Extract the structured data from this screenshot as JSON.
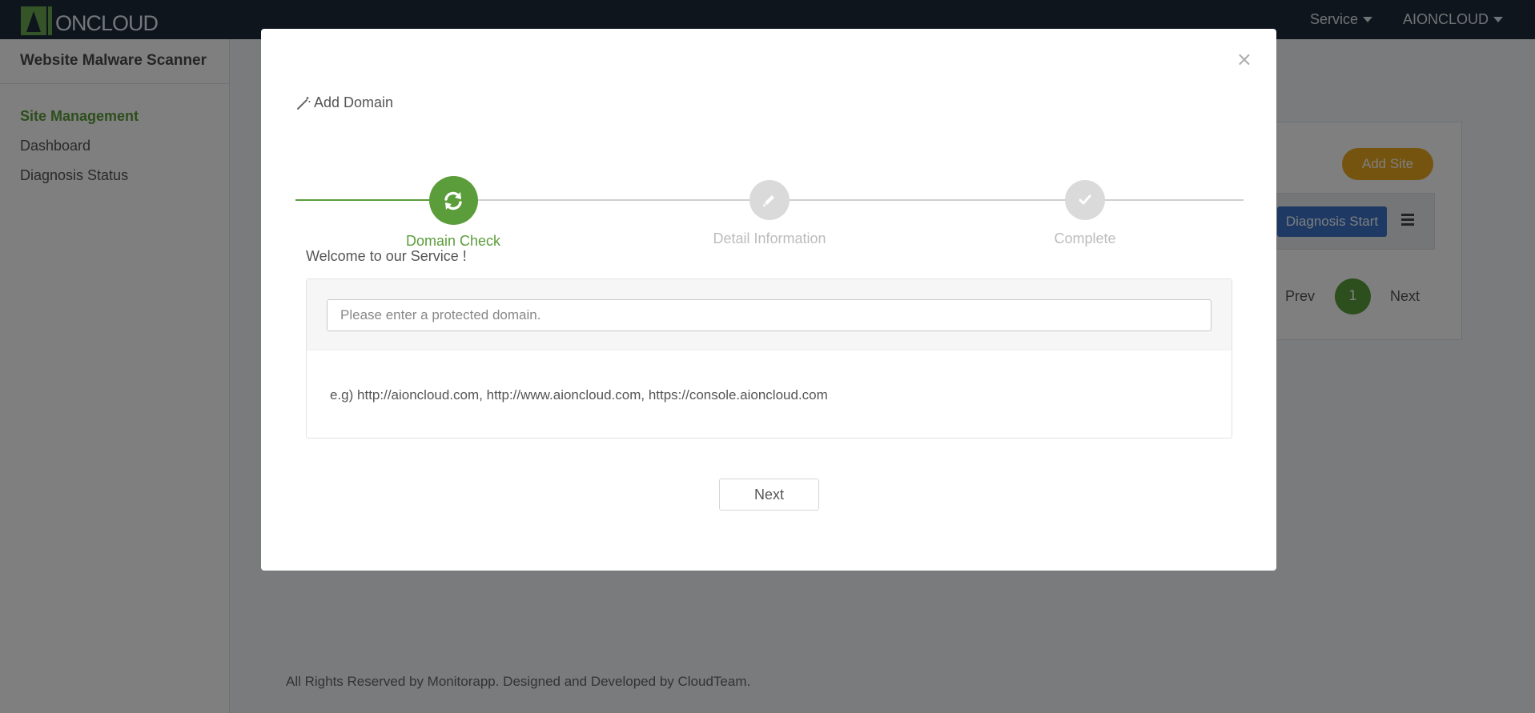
{
  "header": {
    "logo_text": "ONCLOUD",
    "nav": [
      {
        "label": "Service"
      },
      {
        "label": "AIONCLOUD"
      }
    ]
  },
  "sidebar": {
    "title": "Website Malware Scanner",
    "items": [
      {
        "label": "Site Management",
        "active": true
      },
      {
        "label": "Dashboard",
        "active": false
      },
      {
        "label": "Diagnosis Status",
        "active": false
      }
    ]
  },
  "background": {
    "add_site_label": "Add Site",
    "diagnosis_start_label": "Diagnosis Start",
    "pagination": {
      "prev": "Prev",
      "current": "1",
      "next": "Next"
    },
    "footer": "All Rights Reserved by Monitorapp. Designed and Developed by CloudTeam."
  },
  "modal": {
    "close_label": "×",
    "title": "Add Domain",
    "steps": [
      {
        "label": "Domain Check",
        "icon": "refresh-icon",
        "state": "active"
      },
      {
        "label": "Detail Information",
        "icon": "pencil-icon",
        "state": "pending"
      },
      {
        "label": "Complete",
        "icon": "check-icon",
        "state": "pending"
      }
    ],
    "welcome": "Welcome to our Service !",
    "domain_input": {
      "value": "",
      "placeholder": "Please enter a protected domain."
    },
    "example": "e.g) http://aioncloud.com, http://www.aioncloud.com, https://console.aioncloud.com",
    "next_label": "Next"
  },
  "colors": {
    "brand_green": "#5b9d3b",
    "navbar": "#1c2a3a",
    "add_site": "#e8a91f",
    "diagnosis_blue": "#3b73c8"
  }
}
